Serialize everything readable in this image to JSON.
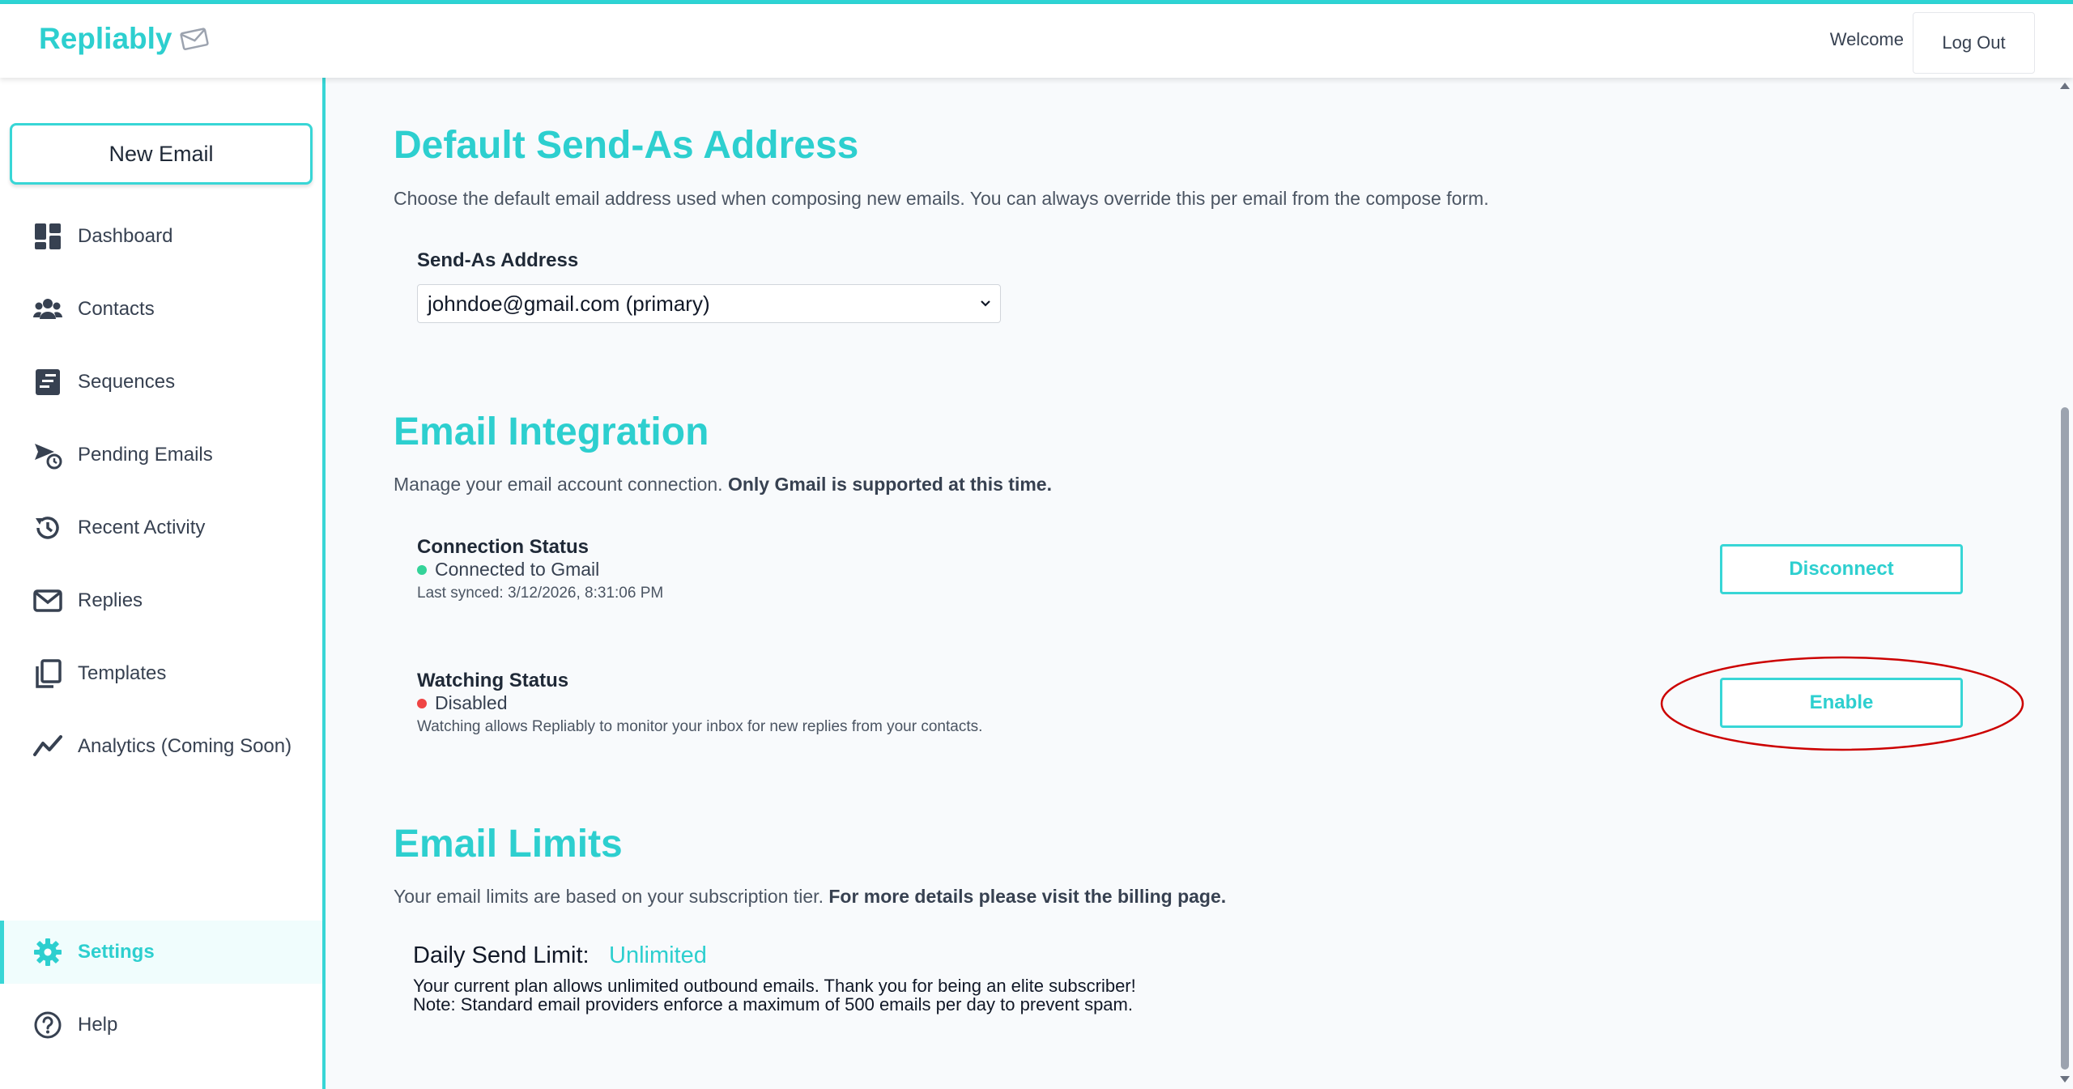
{
  "app": {
    "logo_text": "Repliably",
    "welcome_text": "Welcome",
    "logout_label": "Log Out",
    "accent_color": "#2dcfcf"
  },
  "sidebar": {
    "new_email_label": "New Email",
    "items": [
      {
        "label": "Dashboard",
        "icon": "dashboard-icon"
      },
      {
        "label": "Contacts",
        "icon": "contacts-icon"
      },
      {
        "label": "Sequences",
        "icon": "sequences-icon"
      },
      {
        "label": "Pending Emails",
        "icon": "pending-emails-icon"
      },
      {
        "label": "Recent Activity",
        "icon": "history-icon"
      },
      {
        "label": "Replies",
        "icon": "envelope-icon"
      },
      {
        "label": "Templates",
        "icon": "templates-icon"
      },
      {
        "label": "Analytics (Coming Soon)",
        "icon": "analytics-icon"
      }
    ],
    "bottom_items": [
      {
        "label": "Settings",
        "icon": "gear-icon",
        "active": true
      },
      {
        "label": "Help",
        "icon": "help-icon"
      }
    ]
  },
  "send_as": {
    "title": "Default Send-As Address",
    "description": "Choose the default email address used when composing new emails. You can always override this per email from the compose form.",
    "field_label": "Send-As Address",
    "selected_value": "johndoe@gmail.com (primary)"
  },
  "integration": {
    "title": "Email Integration",
    "description_plain": "Manage your email account connection. ",
    "description_bold": "Only Gmail is supported at this time.",
    "connection": {
      "label": "Connection Status",
      "status": "Connected to Gmail",
      "status_color": "#34d399",
      "last_synced": "Last synced: 3/12/2026, 8:31:06 PM",
      "button_label": "Disconnect"
    },
    "watching": {
      "label": "Watching Status",
      "status": "Disabled",
      "status_color": "#ef4444",
      "note": "Watching allows Repliably to monitor your inbox for new replies from your contacts.",
      "button_label": "Enable"
    }
  },
  "limits": {
    "title": "Email Limits",
    "description_plain": "Your email limits are based on your subscription tier. ",
    "description_bold": "For more details please visit the billing page.",
    "daily_label": "Daily Send Limit:",
    "daily_value": "Unlimited",
    "note_1": "Your current plan allows unlimited outbound emails. Thank you for being an elite subscriber!",
    "note_2": "Note: Standard email providers enforce a maximum of 500 emails per day to prevent spam."
  }
}
